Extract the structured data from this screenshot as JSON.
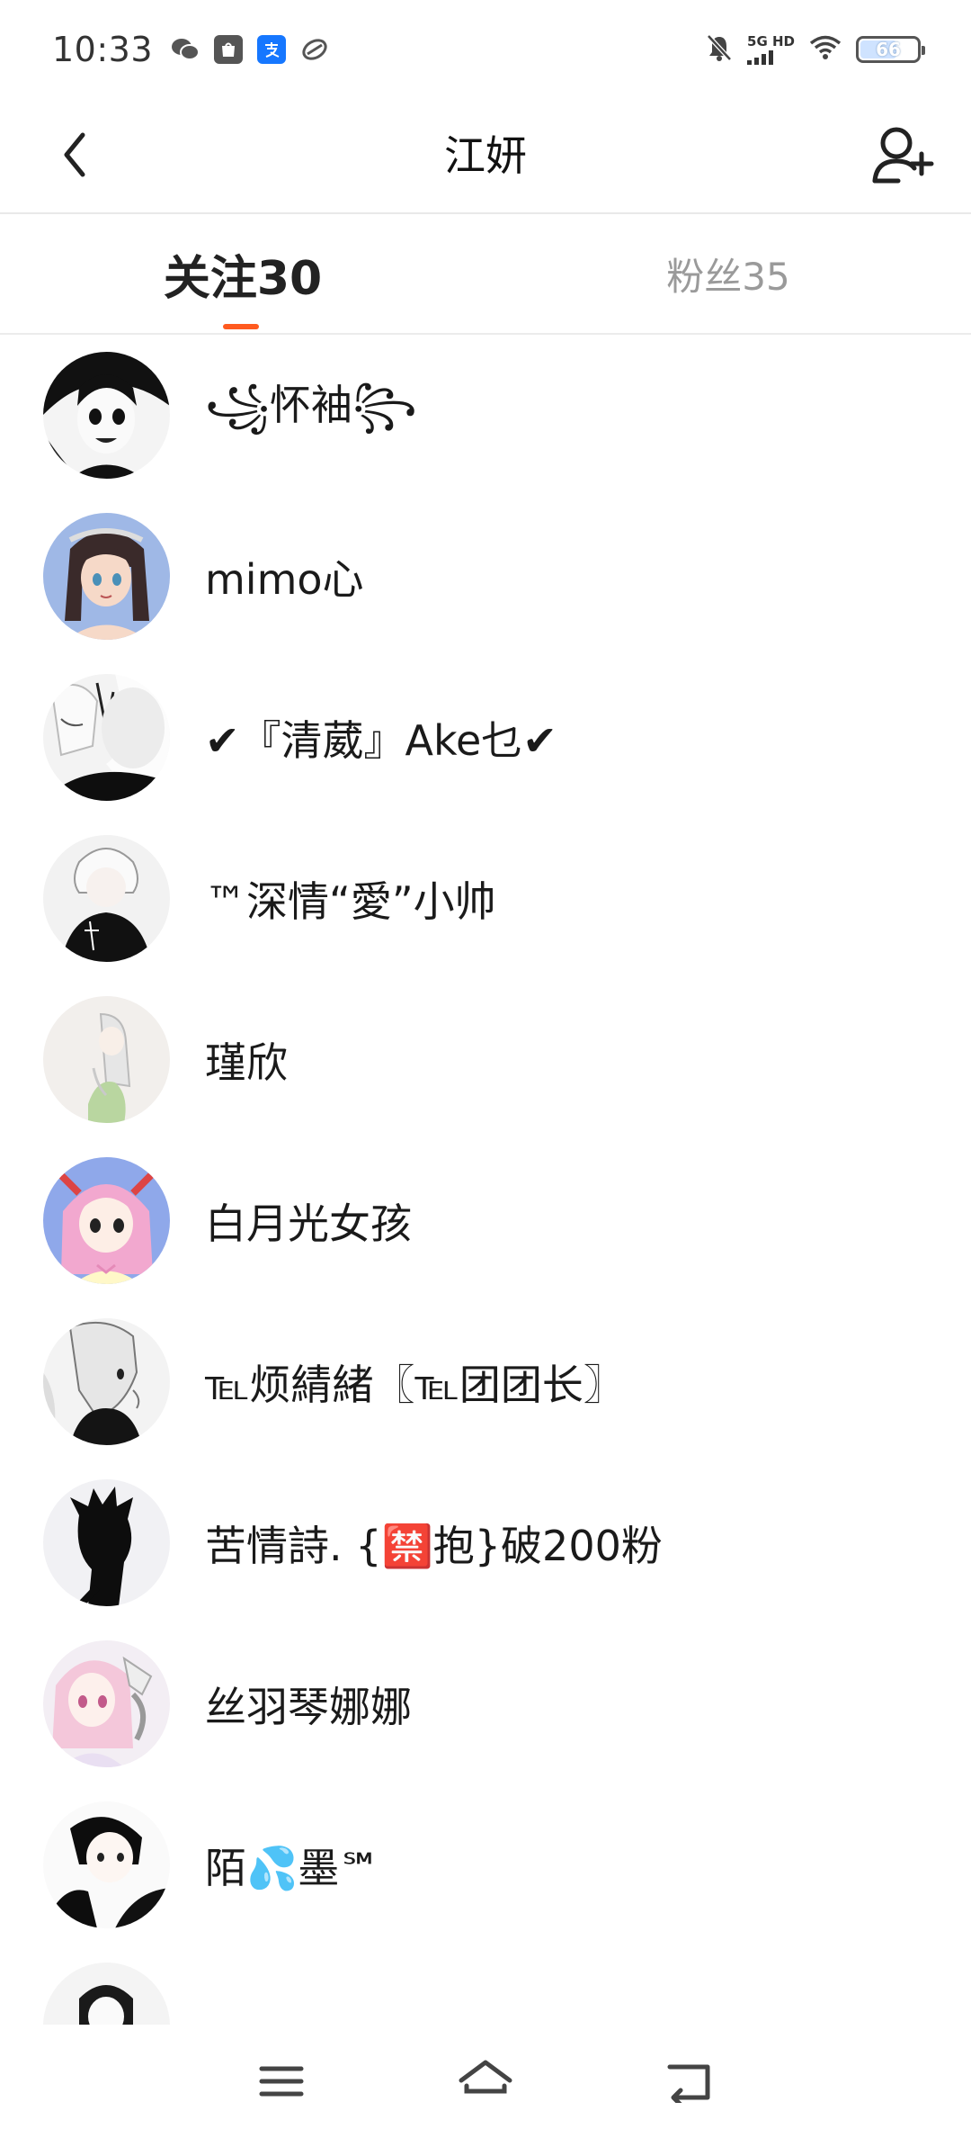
{
  "status_bar": {
    "time": "10:33",
    "network_top": "5G HD",
    "battery_level": "66",
    "battery_fraction": 0.66,
    "icons": [
      "wechat-icon",
      "shopping-bag-icon",
      "alipay-icon",
      "cloud-app-icon",
      "bell-muted-icon",
      "signal-icon",
      "wifi-icon",
      "battery-icon"
    ]
  },
  "header": {
    "title": "江妍",
    "back_icon": "chevron-left-icon",
    "add_user_icon": "add-user-icon"
  },
  "tabs": [
    {
      "label": "关注30",
      "active": true
    },
    {
      "label": "粉丝35",
      "active": false
    }
  ],
  "accent_color": "#ff5a1f",
  "users": [
    {
      "name": "꧁怀袖꧂"
    },
    {
      "name": "mimo心"
    },
    {
      "name": "✔『清葳』Ake乜✔"
    },
    {
      "name": "™深情“愛”小帅"
    },
    {
      "name": "瑾欣"
    },
    {
      "name": "白月光女孩"
    },
    {
      "name": "℡烦綪緒〖℡团团长〗"
    },
    {
      "name": "苦情詩. {🈲抱}破200粉"
    },
    {
      "name": "丝羽琴娜娜"
    },
    {
      "name": "陌💦墨℠"
    }
  ],
  "nav": {
    "menu_icon": "menu-icon",
    "home_icon": "home-icon",
    "back_icon": "back-icon"
  }
}
